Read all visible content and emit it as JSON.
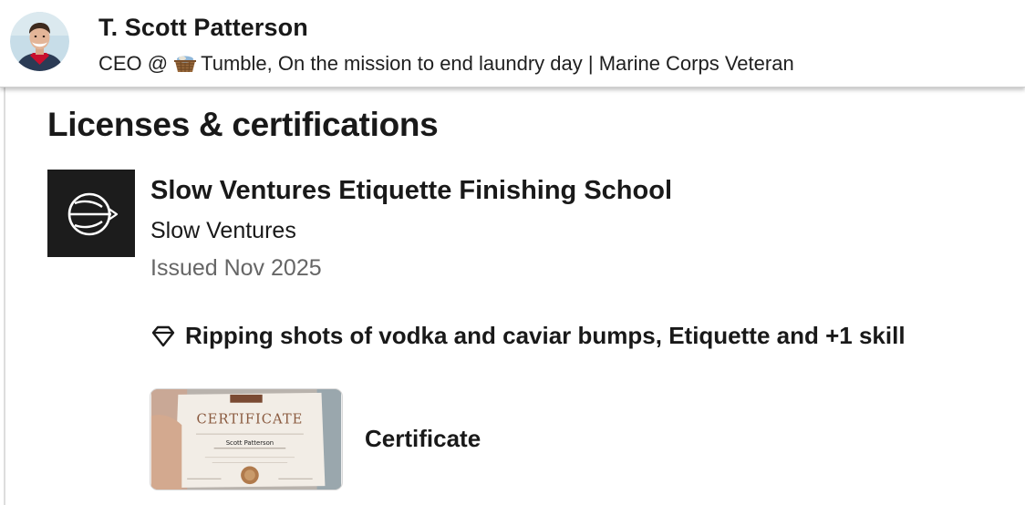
{
  "profile": {
    "name": "T. Scott Patterson",
    "headline_prefix": "CEO @",
    "headline_icon": "basket-emoji-icon",
    "headline_rest": "Tumble, On the mission to end laundry day | Marine Corps Veteran"
  },
  "section": {
    "title": "Licenses & certifications"
  },
  "certification": {
    "name": "Slow Ventures Etiquette Finishing School",
    "issuer": "Slow Ventures",
    "issued": "Issued Nov 2025",
    "logo_icon": "slow-ventures-logo-icon",
    "skills_icon": "diamond-icon",
    "skills": "Ripping shots of vodka and caviar bumps, Etiquette and +1 skill",
    "media": {
      "label": "Certificate",
      "thumb_title": "CERTIFICATE",
      "thumb_name": "Scott Patterson"
    }
  },
  "colors": {
    "text_primary": "#191919",
    "text_secondary": "#666666",
    "logo_bg": "#1c1c1c"
  }
}
